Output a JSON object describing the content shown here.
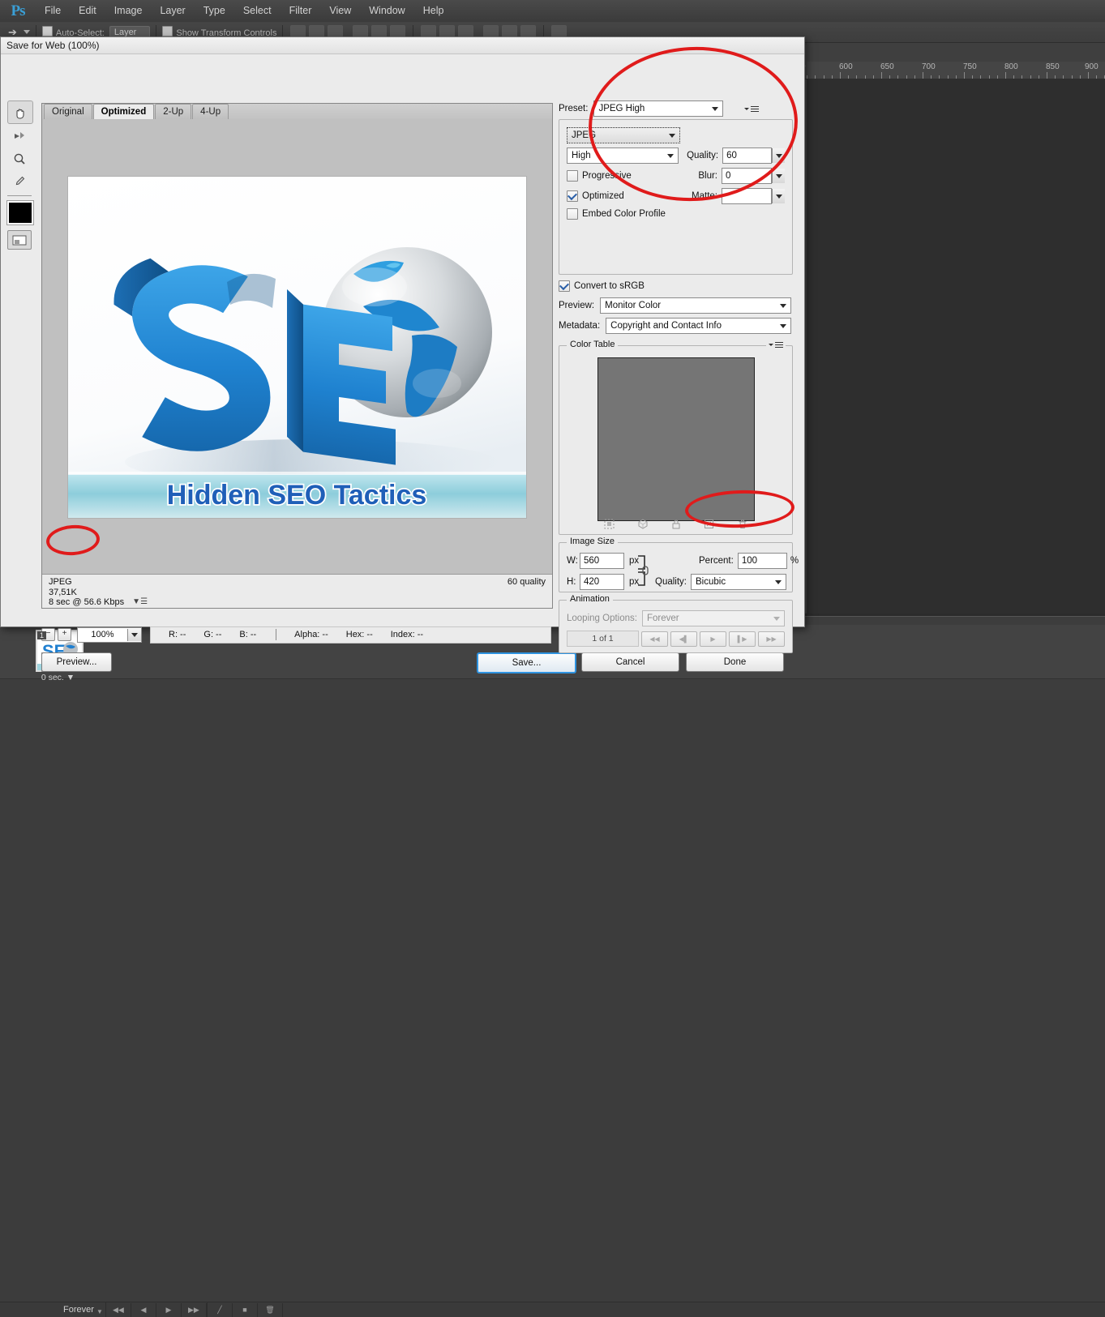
{
  "app": {
    "logo": "Ps",
    "menu": [
      "File",
      "Edit",
      "Image",
      "Layer",
      "Type",
      "Select",
      "Filter",
      "View",
      "Window",
      "Help"
    ],
    "options_bar": {
      "auto_select_label": "Auto-Select:",
      "auto_select_value": "Layer",
      "show_transform_label": "Show Transform Controls"
    },
    "ruler_ticks": [
      "600",
      "650",
      "700",
      "750",
      "800",
      "850",
      "900"
    ]
  },
  "timeline": {
    "frame_number": "1",
    "frame_duration": "0 sec.",
    "looping": "Forever"
  },
  "dialog": {
    "title": "Save for Web (100%)"
  },
  "tools": [
    {
      "name": "hand-tool",
      "selected": true
    },
    {
      "name": "slice-select-tool",
      "selected": false
    },
    {
      "name": "zoom-tool",
      "selected": false
    },
    {
      "name": "eyedropper-tool",
      "selected": false
    }
  ],
  "preview": {
    "tabs": [
      "Original",
      "Optimized",
      "2-Up",
      "4-Up"
    ],
    "active_tab": "Optimized",
    "image_caption": "Hidden SEO Tactics",
    "info": {
      "format": "JPEG",
      "filesize": "37,51K",
      "download": "8 sec @ 56.6 Kbps",
      "quality": "60 quality"
    }
  },
  "zoom_row": {
    "minus": "−",
    "plus": "+",
    "zoom": "100%",
    "r": "R: --",
    "g": "G: --",
    "b": "B: --",
    "alpha": "Alpha: --",
    "hex": "Hex: --",
    "index": "Index: --"
  },
  "buttons": {
    "preview": "Preview...",
    "save": "Save...",
    "cancel": "Cancel",
    "done": "Done"
  },
  "settings": {
    "preset_label": "Preset:",
    "preset_value": "JPEG High",
    "format_value": "JPEG",
    "compression_value": "High",
    "quality_label": "Quality:",
    "quality_value": "60",
    "progressive_label": "Progressive",
    "progressive_checked": false,
    "blur_label": "Blur:",
    "blur_value": "0",
    "optimized_label": "Optimized",
    "optimized_checked": true,
    "matte_label": "Matte:",
    "matte_value": "",
    "embed_profile_label": "Embed Color Profile",
    "embed_profile_checked": false,
    "convert_srgb_label": "Convert to sRGB",
    "convert_srgb_checked": true,
    "preview_label": "Preview:",
    "preview_value": "Monitor Color",
    "metadata_label": "Metadata:",
    "metadata_value": "Copyright and Contact Info"
  },
  "color_table": {
    "title": "Color Table",
    "icons": [
      "transparency-icon",
      "web-shift-icon",
      "lock-icon",
      "new-color-icon",
      "delete-icon"
    ]
  },
  "image_size": {
    "title": "Image Size",
    "w_label": "W:",
    "w_value": "560",
    "w_unit": "px",
    "h_label": "H:",
    "h_value": "420",
    "h_unit": "px",
    "percent_label": "Percent:",
    "percent_value": "100",
    "percent_unit": "%",
    "quality_label": "Quality:",
    "quality_value": "Bicubic"
  },
  "animation": {
    "title": "Animation",
    "looping_label": "Looping Options:",
    "looping_value": "Forever",
    "frame_counter": "1 of 1",
    "controls": [
      "first-frame-button",
      "previous-frame-button",
      "play-button",
      "next-frame-button",
      "last-frame-button"
    ]
  },
  "colors": {
    "annotation_red": "#e01b1b",
    "dialog_bg": "#ebebeb",
    "app_bg": "#3f3f3f",
    "accent_blue": "#2e93e0"
  }
}
